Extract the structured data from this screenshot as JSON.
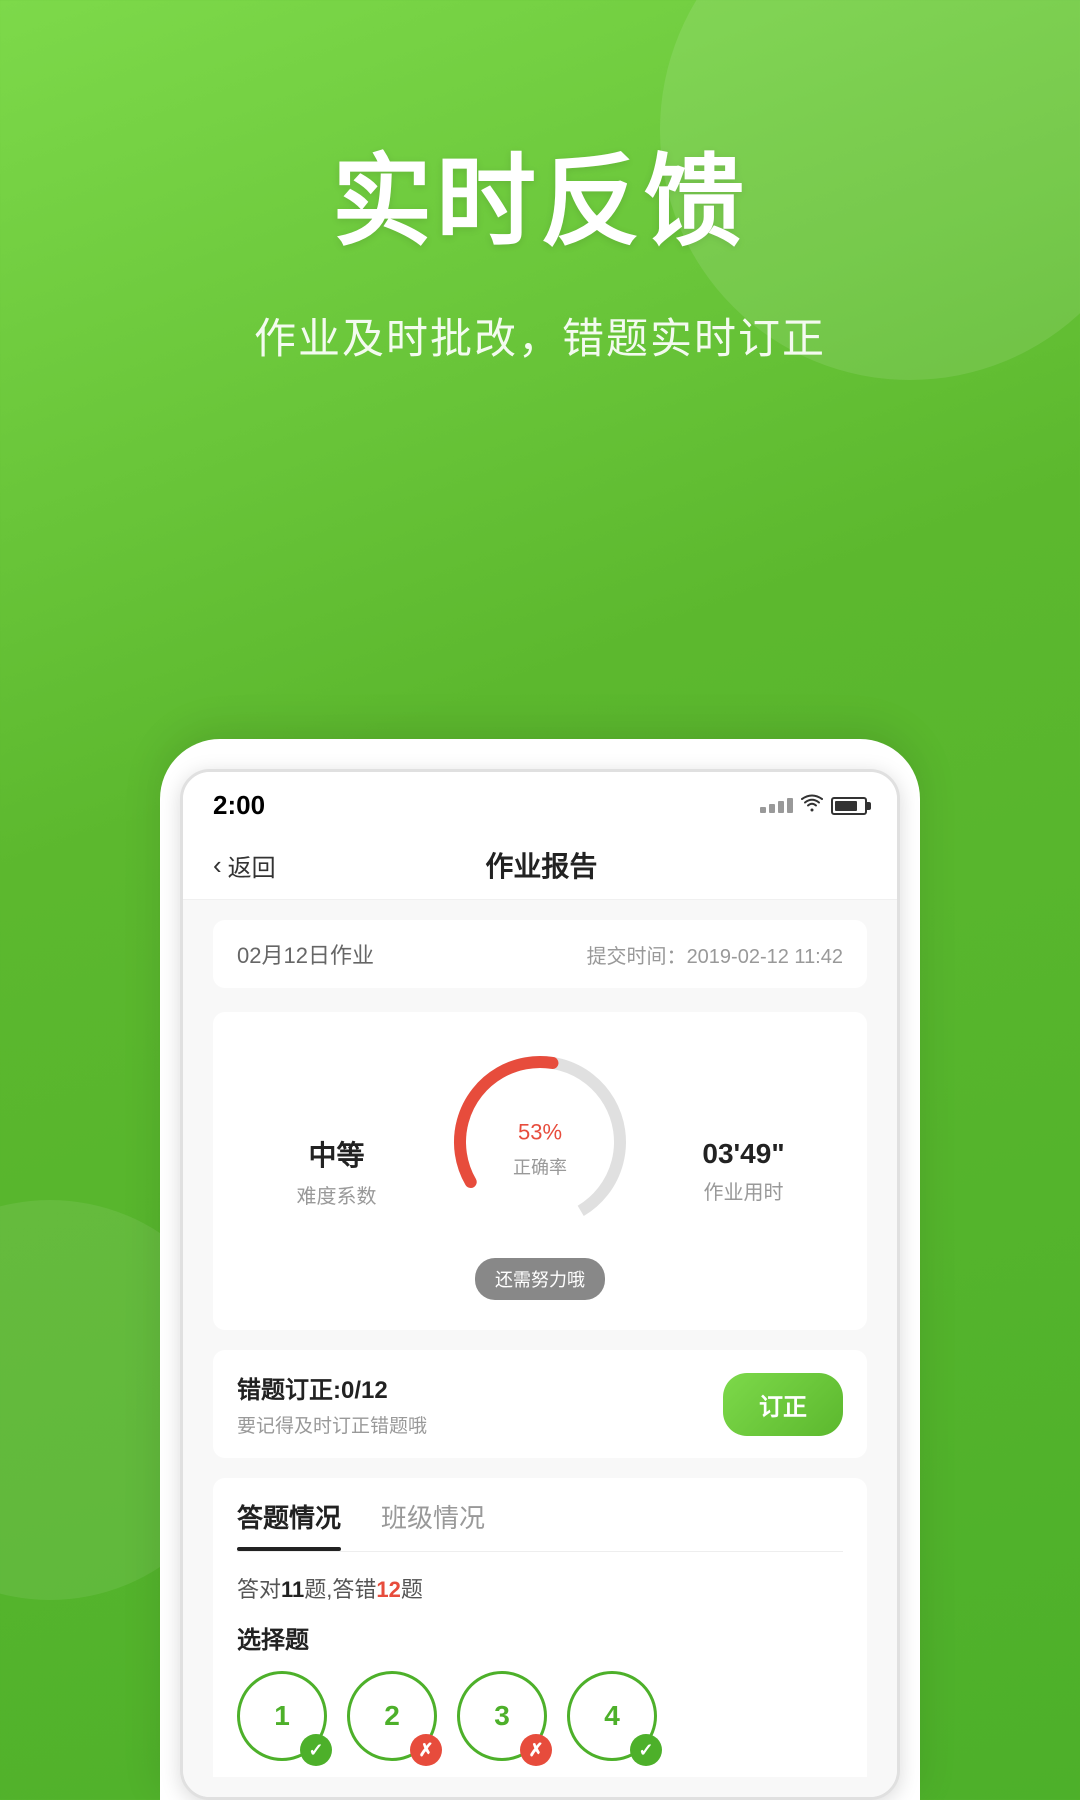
{
  "hero": {
    "title": "实时反馈",
    "subtitle": "作业及时批改，错题实时订正"
  },
  "phone": {
    "status_bar": {
      "time": "2:00",
      "signal": ".....",
      "wifi": "WiFi",
      "battery": "80%"
    },
    "nav": {
      "back_label": "返回",
      "title": "作业报告"
    },
    "report": {
      "date": "02月12日作业",
      "submit_time_label": "提交时间：",
      "submit_time": "2019-02-12 11:42"
    },
    "stats": {
      "difficulty_label": "中等",
      "difficulty_sub": "难度系数",
      "percent": "53",
      "percent_unit": "%",
      "percent_label": "正确率",
      "comment": "还需努力哦",
      "time_value": "03'49\"",
      "time_label": "作业用时"
    },
    "error_correction": {
      "title": "错题订正:0/12",
      "hint": "要记得及时订正错题哦",
      "button_label": "订正"
    },
    "tabs": {
      "items": [
        {
          "label": "答题情况",
          "active": true
        },
        {
          "label": "班级情况",
          "active": false
        }
      ]
    },
    "answer_section": {
      "summary": "答对11题,答错12题",
      "correct_count": "11",
      "wrong_count": "12",
      "question_type": "选择题",
      "questions": [
        {
          "number": "1",
          "status": "correct"
        },
        {
          "number": "2",
          "status": "wrong"
        },
        {
          "number": "3",
          "status": "wrong"
        },
        {
          "number": "4",
          "status": "correct"
        }
      ]
    }
  }
}
